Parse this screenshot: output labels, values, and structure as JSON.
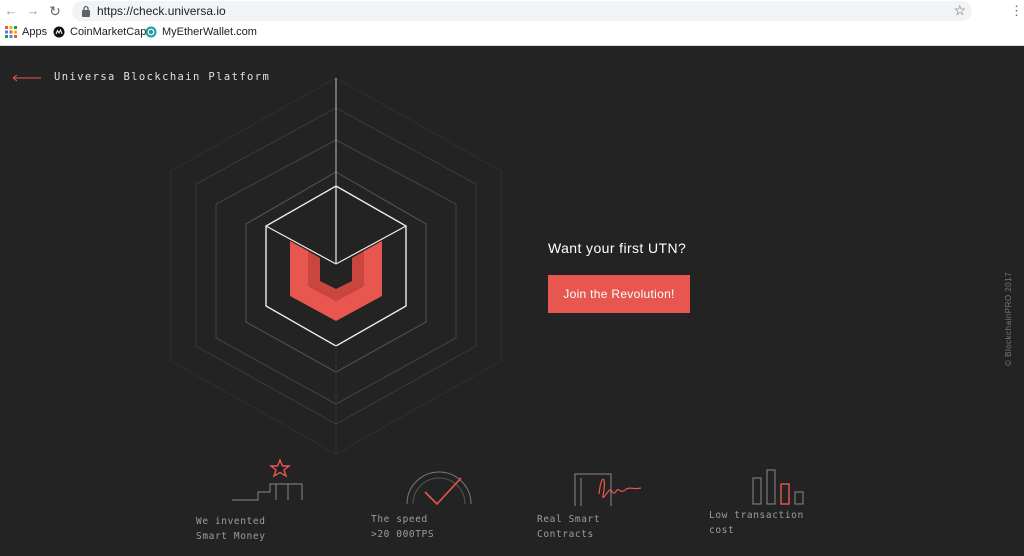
{
  "browser": {
    "url": "https://check.universa.io",
    "bookmarks": [
      {
        "label": "Apps"
      },
      {
        "label": "CoinMarketCap"
      },
      {
        "label": "MyEtherWallet.com"
      }
    ]
  },
  "header": {
    "brand": "Universa Blockchain Platform"
  },
  "cta": {
    "heading": "Want your first UTN?",
    "button_label": "Join the Revolution!"
  },
  "features": [
    {
      "line1": "We invented",
      "line2": "Smart Money"
    },
    {
      "line1": "The speed",
      "line2": ">20 000TPS"
    },
    {
      "line1": "Real Smart",
      "line2": "Contracts"
    },
    {
      "line1": "Low transaction",
      "line2": "cost"
    }
  ],
  "footer": {
    "copyright": "© BlockchainPRO 2017"
  },
  "colors": {
    "accent": "#e8574f",
    "background": "#232323"
  }
}
